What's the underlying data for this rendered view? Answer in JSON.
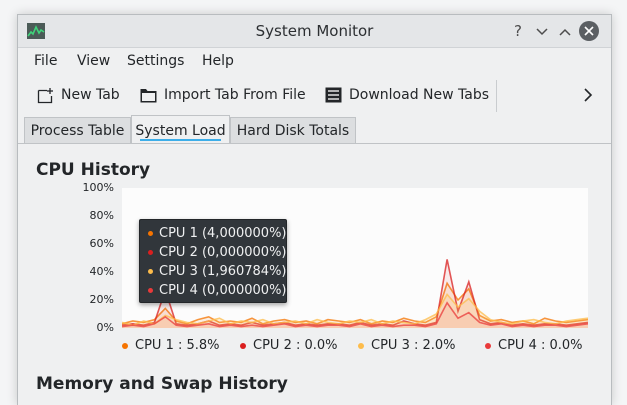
{
  "window": {
    "title": "System Monitor"
  },
  "titlebar_buttons": {
    "help": "?",
    "minimize": "⌄",
    "maximize": "⌃"
  },
  "menu": [
    "File",
    "View",
    "Settings",
    "Help"
  ],
  "toolbar": {
    "new_tab": "New Tab",
    "import_tab": "Import Tab From File",
    "download_tabs": "Download New Tabs"
  },
  "tabs": [
    {
      "label": "Process Table",
      "active": false
    },
    {
      "label": "System Load",
      "active": true
    },
    {
      "label": "Hard Disk Totals",
      "active": false
    }
  ],
  "cpu_section": {
    "title": "CPU History"
  },
  "memory_section": {
    "title": "Memory and Swap History"
  },
  "colors": {
    "cpu1": "#f67400",
    "cpu2": "#da1f1f",
    "cpu3": "#fdbc4b",
    "cpu4": "#e93a3a",
    "accent": "#3daee9"
  },
  "tooltip": [
    "CPU 1 (4,000000%)",
    "CPU 2 (0,000000%)",
    "CPU 3 (1,960784%)",
    "CPU 4 (0,000000%)"
  ],
  "legend": [
    "CPU 1 : 5.8%",
    "CPU 2 : 0.0%",
    "CPU 3 : 2.0%",
    "CPU 4 : 0.0%"
  ],
  "chart_data": {
    "type": "line",
    "title": "CPU History",
    "ylim": [
      0,
      100
    ],
    "y_ticks": [
      "0%",
      "20%",
      "40%",
      "60%",
      "80%",
      "100%"
    ],
    "grid": false,
    "legend_position": "bottom",
    "series": [
      {
        "name": "CPU 1",
        "values": [
          3,
          5,
          4,
          6,
          14,
          5,
          3,
          6,
          8,
          4,
          5,
          4,
          7,
          3,
          5,
          6,
          4,
          5,
          3,
          6,
          5,
          4,
          6,
          3,
          5,
          4,
          7,
          5,
          4,
          8,
          32,
          20,
          28,
          9,
          5,
          6,
          4,
          5,
          3,
          7,
          5,
          4,
          5,
          6
        ]
      },
      {
        "name": "CPU 2",
        "values": [
          2,
          3,
          2,
          4,
          27,
          3,
          2,
          3,
          5,
          2,
          3,
          2,
          4,
          2,
          3,
          4,
          2,
          3,
          2,
          3,
          3,
          2,
          4,
          2,
          3,
          2,
          5,
          3,
          2,
          4,
          49,
          12,
          33,
          6,
          3,
          4,
          2,
          3,
          2,
          3,
          3,
          2,
          3,
          4
        ]
      },
      {
        "name": "CPU 3",
        "values": [
          4,
          2,
          5,
          3,
          9,
          6,
          4,
          3,
          5,
          7,
          3,
          5,
          4,
          6,
          3,
          4,
          5,
          3,
          6,
          4,
          3,
          5,
          4,
          6,
          3,
          5,
          4,
          3,
          6,
          10,
          24,
          15,
          21,
          12,
          6,
          4,
          3,
          5,
          6,
          4,
          3,
          5,
          6,
          7
        ]
      },
      {
        "name": "CPU 4",
        "values": [
          1,
          2,
          1,
          3,
          8,
          2,
          1,
          2,
          3,
          1,
          2,
          1,
          2,
          1,
          2,
          3,
          1,
          2,
          1,
          2,
          2,
          1,
          3,
          1,
          2,
          1,
          2,
          2,
          1,
          3,
          18,
          7,
          11,
          4,
          2,
          3,
          1,
          2,
          1,
          2,
          2,
          1,
          2,
          3
        ]
      }
    ]
  }
}
